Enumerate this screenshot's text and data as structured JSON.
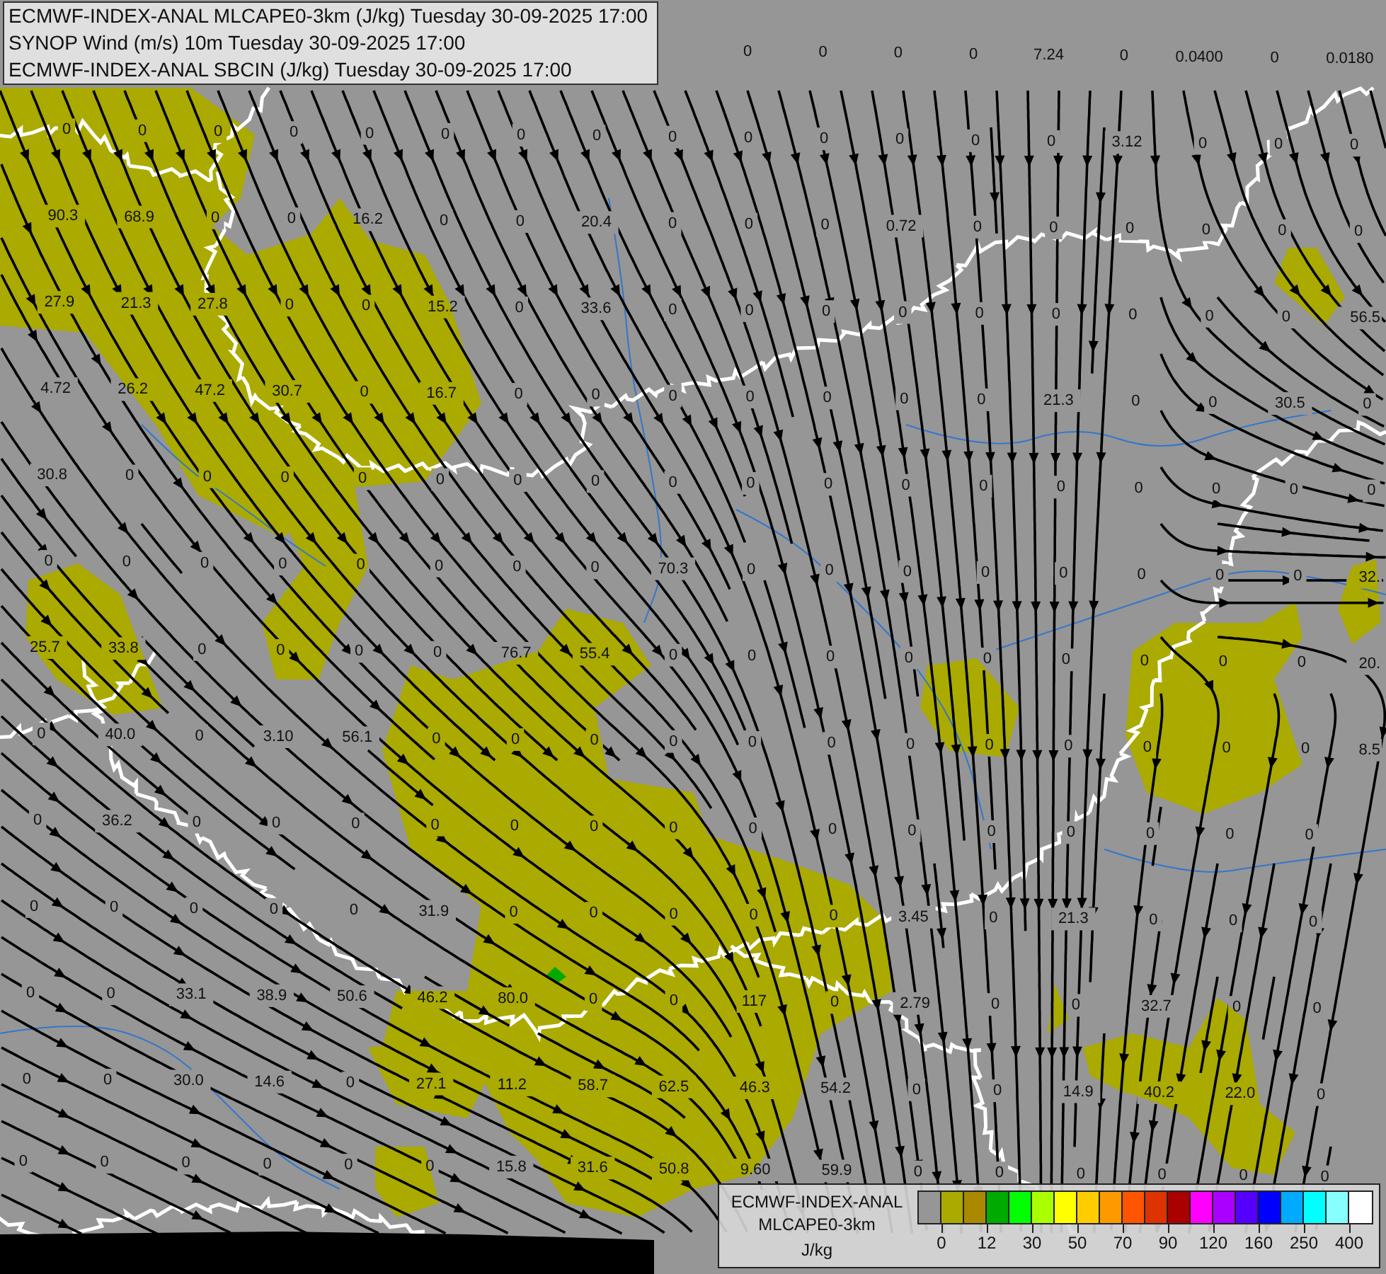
{
  "title_panel": {
    "lines": [
      "ECMWF-INDEX-ANAL MLCAPE0-3km (J/kg) Tuesday 30-09-2025 17:00",
      "SYNOP Wind (m/s) 10m Tuesday 30-09-2025 17:00",
      "ECMWF-INDEX-ANAL SBCIN (J/kg) Tuesday 30-09-2025 17:00"
    ]
  },
  "station_values": [
    {
      "values": [
        "0",
        "0",
        "0",
        "0",
        "7.24",
        "0",
        "0.0400",
        "0",
        "0.0180"
      ]
    },
    {
      "values": [
        "0",
        "0",
        "0",
        "0",
        "0",
        "0",
        "0",
        "0",
        "0",
        "0",
        "0",
        "0",
        "0",
        "0",
        "3.12",
        "0",
        "0",
        "0"
      ]
    },
    {
      "values": [
        "90.3",
        "68.9",
        "0",
        "0",
        "16.2",
        "0",
        "0",
        "20.4",
        "0",
        "0",
        "0",
        "0.72",
        "0",
        "0",
        "0",
        "0",
        "0",
        "0"
      ]
    },
    {
      "values": [
        "27.9",
        "21.3",
        "27.8",
        "0",
        "0",
        "15.2",
        "0",
        "33.6",
        "0",
        "0",
        "0",
        "0",
        "0",
        "0",
        "0",
        "0",
        "0",
        "56.5"
      ]
    },
    {
      "values": [
        "4.72",
        "26.2",
        "47.2",
        "30.7",
        "0",
        "16.7",
        "0",
        "0",
        "0",
        "0",
        "0",
        "0",
        "0",
        "21.3",
        "0",
        "0",
        "30.5",
        "0"
      ]
    },
    {
      "values": [
        "30.8",
        "0",
        "0",
        "0",
        "0",
        "0",
        "0",
        "0",
        "0",
        "0",
        "0",
        "0",
        "0",
        "0",
        "0",
        "0",
        "0",
        "0"
      ]
    },
    {
      "values": [
        "0",
        "0",
        "0",
        "0",
        "0",
        "0",
        "0",
        "0",
        "70.3",
        "0",
        "0",
        "0",
        "0",
        "0",
        "0",
        "0",
        "0",
        "32."
      ]
    },
    {
      "values": [
        "25.7",
        "33.8",
        "0",
        "0",
        "0",
        "0",
        "76.7",
        "55.4",
        "0",
        "0",
        "0",
        "0",
        "0",
        "0",
        "0",
        "0",
        "0",
        "20."
      ]
    },
    {
      "values": [
        "0",
        "40.0",
        "0",
        "3.10",
        "56.1",
        "0",
        "0",
        "0",
        "0",
        "0",
        "0",
        "0",
        "0",
        "0",
        "0",
        "0",
        "0",
        "8.5"
      ]
    },
    {
      "values": [
        "0",
        "36.2",
        "0",
        "0",
        "0",
        "0",
        "0",
        "0",
        "0",
        "0",
        "0",
        "0",
        "0",
        "0",
        "0",
        "0",
        "0"
      ]
    },
    {
      "values": [
        "0",
        "0",
        "0",
        "0",
        "0",
        "31.9",
        "0",
        "0",
        "0",
        "0",
        "0",
        "3.45",
        "0",
        "21.3",
        "0",
        "0",
        "0"
      ]
    },
    {
      "values": [
        "0",
        "0",
        "33.1",
        "38.9",
        "50.6",
        "46.2",
        "80.0",
        "0",
        "0",
        "117",
        "0",
        "2.79",
        "0",
        "0",
        "32.7",
        "0",
        "0"
      ]
    },
    {
      "values": [
        "0",
        "0",
        "30.0",
        "14.6",
        "0",
        "27.1",
        "11.2",
        "58.7",
        "62.5",
        "46.3",
        "54.2",
        "0",
        "0",
        "14.9",
        "40.2",
        "22.0",
        "0"
      ]
    },
    {
      "values": [
        "0",
        "0",
        "0",
        "0",
        "0",
        "0",
        "15.8",
        "31.6",
        "50.8",
        "9.60",
        "59.9",
        "0",
        "0",
        "0",
        "0",
        "0",
        "0"
      ]
    }
  ],
  "legend": {
    "title_lines": [
      "ECMWF-INDEX-ANAL",
      "MLCAPE0-3km"
    ],
    "unit": "J/kg",
    "swatches": [
      {
        "color": "#969696"
      },
      {
        "color": "#aaaa00"
      },
      {
        "color": "#aa8800"
      },
      {
        "color": "#00aa00"
      },
      {
        "color": "#00ff00"
      },
      {
        "color": "#aaff00"
      },
      {
        "color": "#ffff00"
      },
      {
        "color": "#ffcc00"
      },
      {
        "color": "#ff9900"
      },
      {
        "color": "#ff5500"
      },
      {
        "color": "#dd3300"
      },
      {
        "color": "#aa0000"
      },
      {
        "color": "#ff00ff"
      },
      {
        "color": "#aa00ff"
      },
      {
        "color": "#5500ff"
      },
      {
        "color": "#0000ff"
      },
      {
        "color": "#00aaff"
      },
      {
        "color": "#00ffff"
      },
      {
        "color": "#88ffff"
      },
      {
        "color": "#ffffff"
      }
    ],
    "ticks": [
      "0",
      "12",
      "30",
      "50",
      "70",
      "90",
      "120",
      "160",
      "250",
      "400"
    ]
  }
}
